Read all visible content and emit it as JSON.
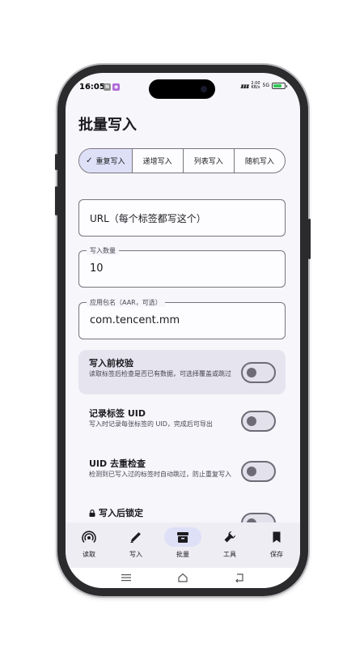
{
  "status": {
    "time": "16:05",
    "signal": "ᵻᵻᵻ",
    "speed_top": "2.00",
    "speed_bottom": "KB/s",
    "network": "5G"
  },
  "page": {
    "title": "批量写入"
  },
  "segments": [
    {
      "label": "重复写入",
      "active": true
    },
    {
      "label": "递增写入",
      "active": false
    },
    {
      "label": "列表写入",
      "active": false
    },
    {
      "label": "随机写入",
      "active": false
    }
  ],
  "fields": {
    "url": {
      "placeholder": "URL（每个标签都写这个）"
    },
    "count": {
      "label": "写入数量",
      "value": "10"
    },
    "package": {
      "label": "应用包名（AAR，可选）",
      "value": "com.tencent.mm"
    }
  },
  "settings": [
    {
      "title": "写入前校验",
      "desc": "读取标签后检查是否已有数据，可选择覆盖或跳过",
      "on": false
    },
    {
      "title": "记录标签 UID",
      "desc": "写入时记录每张标签的 UID，完成后可导出",
      "on": false
    },
    {
      "title": "UID 去重检查",
      "desc": "检测到已写入过的标签时自动跳过，防止重复写入",
      "on": false
    },
    {
      "title": "写入后锁定",
      "on": false
    }
  ],
  "nav": [
    {
      "label": "读取",
      "icon": "nfc-icon",
      "active": false
    },
    {
      "label": "写入",
      "icon": "pencil-icon",
      "active": false
    },
    {
      "label": "批量",
      "icon": "archive-icon",
      "active": true
    },
    {
      "label": "工具",
      "icon": "wrench-icon",
      "active": false
    },
    {
      "label": "保存",
      "icon": "bookmark-icon",
      "active": false
    }
  ],
  "colors": {
    "accent_container": "#dde0f7",
    "background": "#f6f6fb",
    "outline": "#79747e",
    "battery": "#34c759"
  }
}
